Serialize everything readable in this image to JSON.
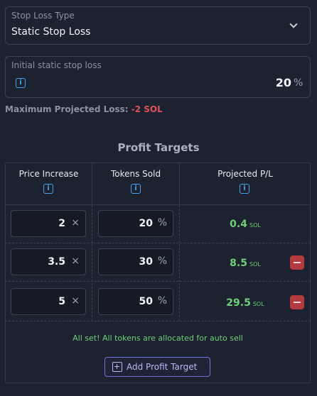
{
  "stop_loss_type": {
    "label": "Stop Loss Type",
    "value": "Static Stop Loss"
  },
  "initial_stop_loss": {
    "label": "Initial static stop loss",
    "value": "20",
    "suffix": "%"
  },
  "max_loss": {
    "label": "Maximum Projected Loss:",
    "value": "-2 SOL"
  },
  "profit_targets": {
    "title": "Profit Targets",
    "headers": [
      "Price Increase",
      "Tokens Sold",
      "Projected P/L"
    ],
    "rows": [
      {
        "price": "2",
        "price_suffix": "×",
        "tokens": "20",
        "tokens_suffix": "%",
        "pl": "0.4",
        "pl_unit": "SOL",
        "removable": false
      },
      {
        "price": "3.5",
        "price_suffix": "×",
        "tokens": "30",
        "tokens_suffix": "%",
        "pl": "8.5",
        "pl_unit": "SOL",
        "removable": true
      },
      {
        "price": "5",
        "price_suffix": "×",
        "tokens": "50",
        "tokens_suffix": "%",
        "pl": "29.5",
        "pl_unit": "SOL",
        "removable": true
      }
    ],
    "status": "All set! All tokens are allocated for auto sell",
    "add_button": "Add Profit Target"
  },
  "icons": {
    "info": "info-icon",
    "dropdown": "chevron-down-icon",
    "remove": "minus-icon",
    "add": "plus-square-icon"
  },
  "colors": {
    "accent": "#4aa3e0",
    "positive": "#6fd07a",
    "negative": "#e0525b",
    "button": "#6f74e2"
  }
}
